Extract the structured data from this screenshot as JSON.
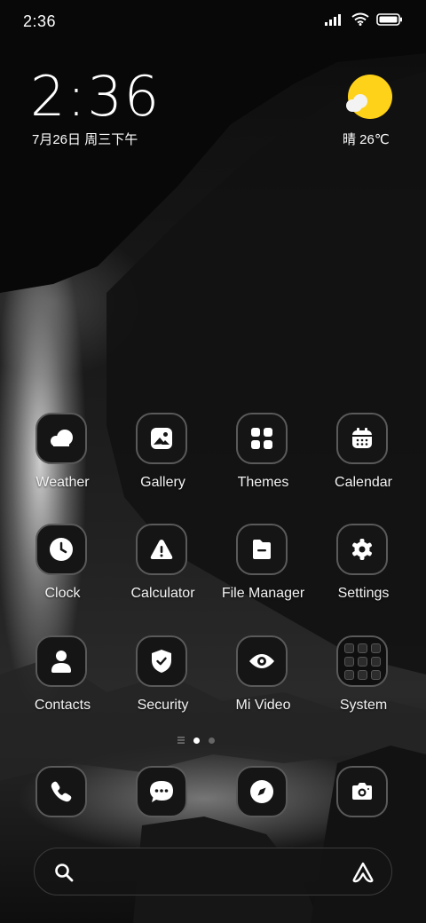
{
  "status_bar": {
    "time": "2:36",
    "icons": [
      "signal-icon",
      "wifi-icon",
      "battery-icon"
    ]
  },
  "clock_widget": {
    "time": "2:36",
    "date": "7月26日 周三下午"
  },
  "weather_widget": {
    "condition_icon": "sunny-cloud-icon",
    "temp": "晴 26℃",
    "sun_color": "#ffd21a"
  },
  "apps": [
    {
      "label": "Weather",
      "icon": "weather-icon"
    },
    {
      "label": "Gallery",
      "icon": "gallery-icon"
    },
    {
      "label": "Themes",
      "icon": "themes-icon"
    },
    {
      "label": "Calendar",
      "icon": "calendar-icon"
    },
    {
      "label": "Clock",
      "icon": "clock-icon"
    },
    {
      "label": "Calculator",
      "icon": "calculator-icon"
    },
    {
      "label": "File Manager",
      "icon": "file-manager-icon"
    },
    {
      "label": "Settings",
      "icon": "settings-icon"
    },
    {
      "label": "Contacts",
      "icon": "contacts-icon"
    },
    {
      "label": "Security",
      "icon": "security-icon"
    },
    {
      "label": "Mi Video",
      "icon": "mi-video-icon"
    },
    {
      "label": "System",
      "icon": "system-folder-icon"
    }
  ],
  "page_indicator": {
    "pages": 2,
    "current": 1
  },
  "dock": [
    {
      "icon": "phone-icon"
    },
    {
      "icon": "messages-icon"
    },
    {
      "icon": "browser-icon"
    },
    {
      "icon": "camera-icon"
    }
  ],
  "search_bar": {
    "left_icon": "search-icon",
    "right_icon": "assistant-icon"
  },
  "colors": {
    "icon_bg": "#151515",
    "icon_border": "#5a5a5a",
    "text": "#ffffff",
    "sun": "#ffd21a"
  }
}
